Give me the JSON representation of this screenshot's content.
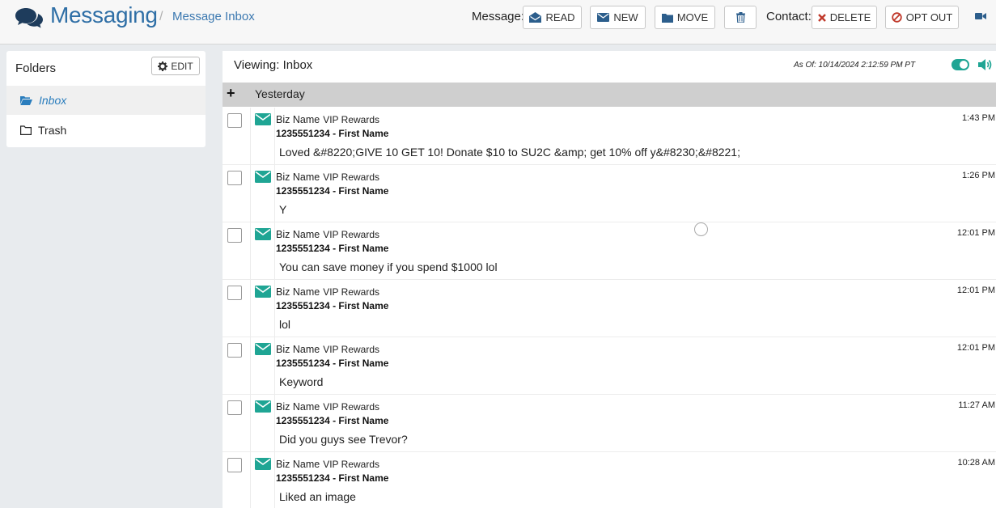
{
  "header": {
    "app_title": "Messaging",
    "separator": "/",
    "breadcrumb": "Message Inbox",
    "message_label": "Message:",
    "contact_label": "Contact:",
    "buttons": {
      "read": "READ",
      "new": "NEW",
      "move": "MOVE",
      "delete": "DELETE",
      "opt_out": "OPT OUT"
    }
  },
  "folders": {
    "title": "Folders",
    "edit_label": "EDIT",
    "items": [
      {
        "label": "Inbox",
        "active": true
      },
      {
        "label": "Trash",
        "active": false
      }
    ]
  },
  "main": {
    "viewing": "Viewing: Inbox",
    "as_of": "As Of: 10/14/2024 2:12:59 PM PT",
    "group": {
      "label": "Yesterday",
      "toggle_symbol": "+"
    },
    "messages": [
      {
        "sender": "Biz Name",
        "list": "VIP Rewards",
        "contact": "1235551234 - First Name",
        "text": "Loved &#8220;GIVE 10 GET 10! Donate $10 to SU2C &amp; get 10% off y&#8230;&#8221;",
        "time": "1:43 PM"
      },
      {
        "sender": "Biz Name",
        "list": "VIP Rewards",
        "contact": "1235551234 - First Name",
        "text": "Y",
        "time": "1:26 PM"
      },
      {
        "sender": "Biz Name",
        "list": "VIP Rewards",
        "contact": "1235551234 - First Name",
        "text": "You can save money if you spend $1000 lol",
        "time": "12:01 PM"
      },
      {
        "sender": "Biz Name",
        "list": "VIP Rewards",
        "contact": "1235551234 - First Name",
        "text": "lol",
        "time": "12:01 PM"
      },
      {
        "sender": "Biz Name",
        "list": "VIP Rewards",
        "contact": "1235551234 - First Name",
        "text": "Keyword",
        "time": "12:01 PM"
      },
      {
        "sender": "Biz Name",
        "list": "VIP Rewards",
        "contact": "1235551234 - First Name",
        "text": "Did you guys see Trevor?",
        "time": "11:27 AM"
      },
      {
        "sender": "Biz Name",
        "list": "VIP Rewards",
        "contact": "1235551234 - First Name",
        "text": "Liked an image",
        "time": "10:28 AM"
      }
    ]
  },
  "colors": {
    "brand_blue": "#2f6fa6",
    "accent_teal": "#1fa594",
    "link_blue": "#2a7dbd",
    "delete_red": "#c0392b"
  }
}
